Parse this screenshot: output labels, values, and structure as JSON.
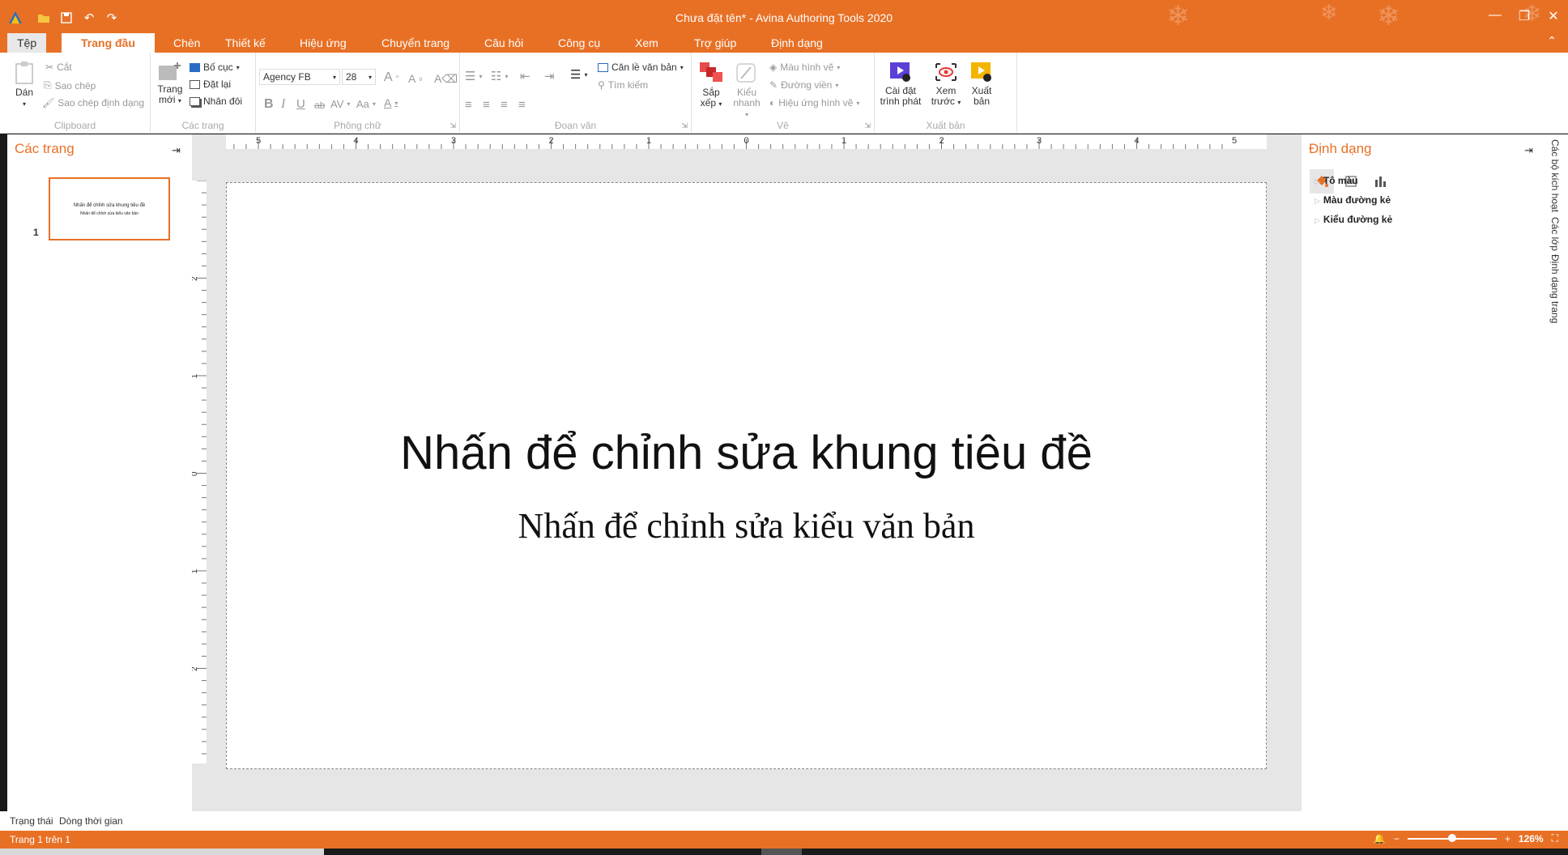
{
  "window": {
    "title": "Chưa đặt tên* - Avina Authoring Tools 2020",
    "accent": "#e87025",
    "controls": [
      "minimize-icon",
      "restore-icon",
      "close-icon"
    ]
  },
  "quick_access": [
    "open-folder-icon",
    "save-icon",
    "undo-icon",
    "redo-icon"
  ],
  "menu": {
    "file": "Tệp",
    "tabs": [
      "Trang đầu",
      "Chèn",
      "Thiết kế",
      "Hiệu ứng",
      "Chuyển trang",
      "Câu hỏi",
      "Công cụ",
      "Xem",
      "Trợ giúp",
      "Định dạng"
    ],
    "active": "Trang đầu"
  },
  "ribbon": {
    "clipboard": {
      "label": "Clipboard",
      "paste": "Dán",
      "cut": "Cắt",
      "copy": "Sao chép",
      "format_painter": "Sao chép định dạng"
    },
    "pages": {
      "label": "Các trang",
      "new_page_l1": "Trang",
      "new_page_l2": "mới",
      "layout": "Bố cục",
      "reset": "Đặt lại",
      "duplicate": "Nhân đôi"
    },
    "font": {
      "label": "Phông chữ",
      "family": "Agency FB",
      "size": "28"
    },
    "paragraph": {
      "label": "Đoạn văn",
      "align_text": "Căn lề văn bản",
      "find": "Tìm kiếm"
    },
    "drawing": {
      "label": "Vẽ",
      "arrange_l1": "Sắp",
      "arrange_l2": "xếp",
      "quick_style_l1": "Kiểu",
      "quick_style_l2": "nhanh",
      "shape_fill": "Màu hình vẽ",
      "outline": "Đường viền",
      "shape_effects": "Hiệu ứng hình vẽ"
    },
    "publish": {
      "label": "Xuất bản",
      "player_l1": "Cài đặt",
      "player_l2": "trình phát",
      "preview_l1": "Xem",
      "preview_l2": "trước",
      "publish_l1": "Xuất",
      "publish_l2": "bản"
    }
  },
  "pages_pane": {
    "title": "Các trang",
    "thumb_title": "Nhấn để chỉnh sửa khung tiêu đề",
    "thumb_sub": "Nhấn để chỉnh sửa kiểu văn bản",
    "page_number": "1"
  },
  "ruler": {
    "h_labels": [
      "5",
      "4",
      "3",
      "2",
      "1",
      "0",
      "1",
      "2",
      "3",
      "4",
      "5"
    ],
    "v_labels": [
      "2",
      "1",
      "0",
      "1",
      "2"
    ]
  },
  "slide": {
    "title": "Nhấn để chỉnh sửa khung tiêu đề",
    "subtitle": "Nhấn để chỉnh sửa kiểu văn bản"
  },
  "format_pane": {
    "title": "Định dạng",
    "items": [
      "Tô màu",
      "Màu đường kẻ",
      "Kiểu đường kẻ"
    ]
  },
  "side_tabs": [
    "Các bộ kích hoạt",
    "Các lớp",
    "Định dạng trang"
  ],
  "bottom_tabs": [
    "Trạng thái",
    "Dòng thời gian"
  ],
  "status": {
    "page": "Trang 1 trên 1",
    "zoom": "126%",
    "zoom_level": 0.5
  }
}
